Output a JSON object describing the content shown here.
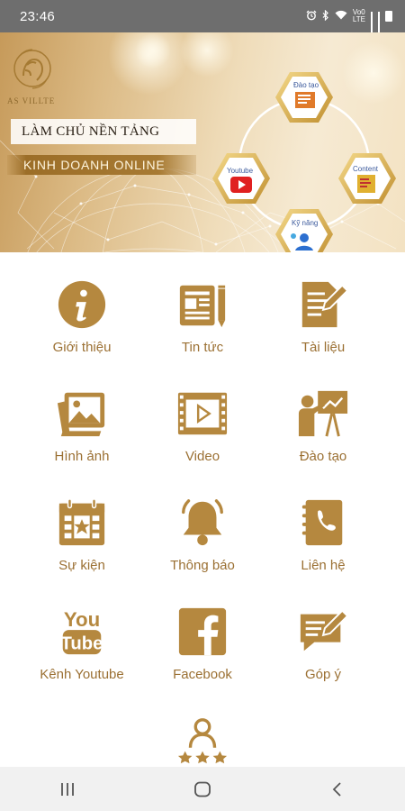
{
  "status_bar": {
    "time": "23:46",
    "network_label_top": "Vo0",
    "network_label_bottom": "LTE"
  },
  "banner": {
    "logo_text": "AS VILLTE",
    "slogan_line1": "LÀM CHỦ NỀN TẢNG",
    "slogan_line2": "KINH DOANH ONLINE",
    "diagram": {
      "top": "Đào tạo",
      "left": "Youtube",
      "right": "Content",
      "bottom": "Kỹ năng"
    }
  },
  "menu": {
    "items": [
      {
        "label": "Giới thiệu",
        "icon": "info-icon"
      },
      {
        "label": "Tin tức",
        "icon": "news-icon"
      },
      {
        "label": "Tài liệu",
        "icon": "document-icon"
      },
      {
        "label": "Hình ảnh",
        "icon": "images-icon"
      },
      {
        "label": "Video",
        "icon": "video-icon"
      },
      {
        "label": "Đào tạo",
        "icon": "training-icon"
      },
      {
        "label": "Sự kiện",
        "icon": "calendar-icon"
      },
      {
        "label": "Thông báo",
        "icon": "bell-icon"
      },
      {
        "label": "Liên hệ",
        "icon": "contact-icon"
      },
      {
        "label": "Kênh Youtube",
        "icon": "youtube-icon"
      },
      {
        "label": "Facebook",
        "icon": "facebook-icon"
      },
      {
        "label": "Góp ý",
        "icon": "feedback-icon"
      },
      {
        "label": "",
        "icon": "rating-icon"
      }
    ]
  },
  "colors": {
    "accent": "#b5883f",
    "label": "#9b7033",
    "status_bar": "#6e6e6e",
    "nav_bar": "#f1f1f1"
  },
  "nav": {
    "recent": "recent-apps-icon",
    "home": "home-icon",
    "back": "back-icon"
  }
}
